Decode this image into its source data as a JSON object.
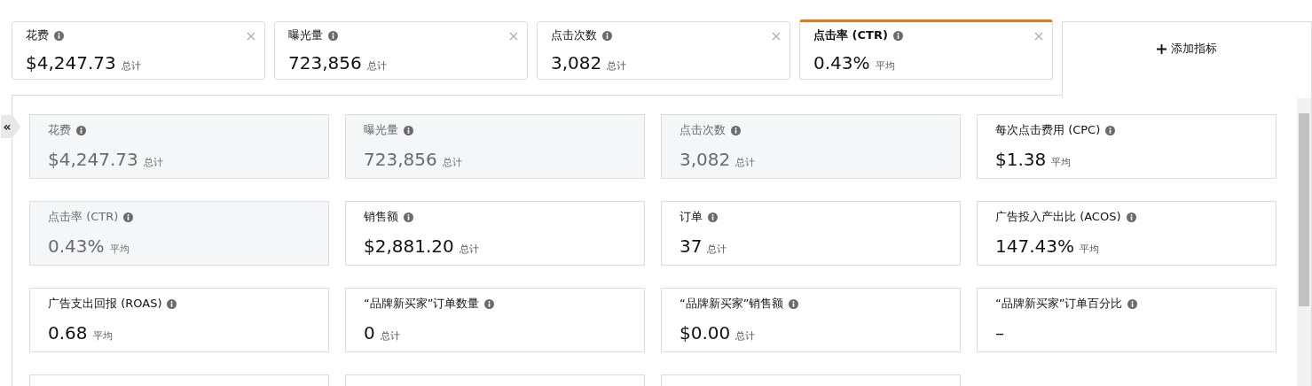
{
  "tabs": [
    {
      "label": "花费",
      "value": "$4,247.73",
      "unit": "总计",
      "selected": false
    },
    {
      "label": "曝光量",
      "value": "723,856",
      "unit": "总计",
      "selected": false
    },
    {
      "label": "点击次数",
      "value": "3,082",
      "unit": "总计",
      "selected": false
    },
    {
      "label": "点击率 (CTR)",
      "value": "0.43%",
      "unit": "平均",
      "selected": true
    }
  ],
  "add_metric_button": "添加指标",
  "collapse_button": "«",
  "metric_cards": [
    {
      "label": "花费",
      "value": "$4,247.73",
      "unit": "总计",
      "selected": true
    },
    {
      "label": "曝光量",
      "value": "723,856",
      "unit": "总计",
      "selected": true
    },
    {
      "label": "点击次数",
      "value": "3,082",
      "unit": "总计",
      "selected": true
    },
    {
      "label": "每次点击费用 (CPC)",
      "value": "$1.38",
      "unit": "平均",
      "selected": false
    },
    {
      "label": "点击率 (CTR)",
      "value": "0.43%",
      "unit": "平均",
      "selected": true
    },
    {
      "label": "销售额",
      "value": "$2,881.20",
      "unit": "总计",
      "selected": false
    },
    {
      "label": "订单",
      "value": "37",
      "unit": "总计",
      "selected": false
    },
    {
      "label": "广告投入产出比 (ACOS)",
      "value": "147.43%",
      "unit": "平均",
      "selected": false
    },
    {
      "label": "广告支出回报 (ROAS)",
      "value": "0.68",
      "unit": "平均",
      "selected": false
    },
    {
      "label": "“品牌新买家”订单数量",
      "value": "0",
      "unit": "总计",
      "selected": false
    },
    {
      "label": "“品牌新买家”销售额",
      "value": "$0.00",
      "unit": "总计",
      "selected": false
    },
    {
      "label": "“品牌新买家”订单百分比",
      "value": "–",
      "selected": false
    }
  ]
}
